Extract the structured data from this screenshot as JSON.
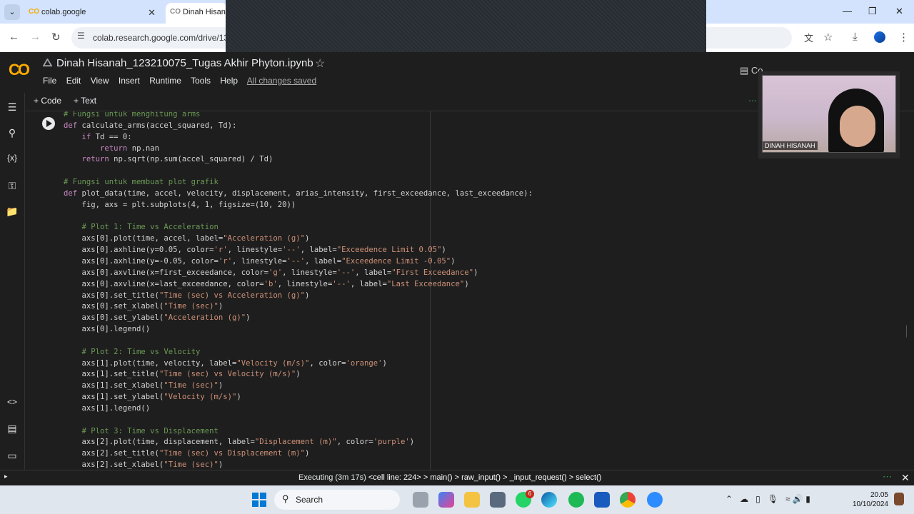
{
  "browser": {
    "tabs": [
      {
        "label": "colab.google"
      },
      {
        "label": "Dinah Hisanah"
      }
    ],
    "url": "colab.research.google.com/drive/13"
  },
  "notebook": {
    "title": "Dinah Hisanah_123210075_Tugas Akhir Phyton.ipynb",
    "menu": [
      "File",
      "Edit",
      "View",
      "Insert",
      "Runtime",
      "Tools",
      "Help"
    ],
    "saved_status": "All changes saved",
    "comment_label": "Co"
  },
  "toolbar": {
    "code_label": "+ Code",
    "text_label": "+ Text"
  },
  "code_lines": [
    "# Fungsi untuk menghitung arms",
    "def calculate_arms(accel_squared, Td):",
    "    if Td == 0:",
    "        return np.nan",
    "    return np.sqrt(np.sum(accel_squared) / Td)",
    "",
    "# Fungsi untuk membuat plot grafik",
    "def plot_data(time, accel, velocity, displacement, arias_intensity, first_exceedance, last_exceedance):",
    "    fig, axs = plt.subplots(4, 1, figsize=(10, 20))",
    "",
    "    # Plot 1: Time vs Acceleration",
    "    axs[0].plot(time, accel, label=\"Acceleration (g)\")",
    "    axs[0].axhline(y=0.05, color='r', linestyle='--', label=\"Exceedence Limit 0.05\")",
    "    axs[0].axhline(y=-0.05, color='r', linestyle='--', label=\"Exceedence Limit -0.05\")",
    "    axs[0].axvline(x=first_exceedance, color='g', linestyle='--', label=\"First Exceedance\")",
    "    axs[0].axvline(x=last_exceedance, color='b', linestyle='--', label=\"Last Exceedance\")",
    "    axs[0].set_title(\"Time (sec) vs Acceleration (g)\")",
    "    axs[0].set_xlabel(\"Time (sec)\")",
    "    axs[0].set_ylabel(\"Acceleration (g)\")",
    "    axs[0].legend()",
    "",
    "    # Plot 2: Time vs Velocity",
    "    axs[1].plot(time, velocity, label=\"Velocity (m/s)\", color='orange')",
    "    axs[1].set_title(\"Time (sec) vs Velocity (m/s)\")",
    "    axs[1].set_xlabel(\"Time (sec)\")",
    "    axs[1].set_ylabel(\"Velocity (m/s)\")",
    "    axs[1].legend()",
    "",
    "    # Plot 3: Time vs Displacement",
    "    axs[2].plot(time, displacement, label=\"Displacement (m)\", color='purple')",
    "    axs[2].set_title(\"Time (sec) vs Displacement (m)\")",
    "    axs[2].set_xlabel(\"Time (sec)\")"
  ],
  "status": {
    "executing": "Executing (3m 17s)",
    "trace": "<cell line: 224> > main() > raw_input() > _input_request() > select()"
  },
  "webcam": {
    "name": "DINAH HISANAH"
  },
  "taskbar": {
    "search_label": "Search",
    "whatsapp_badge": "6",
    "time": "20.05",
    "date": "10/10/2024"
  },
  "colors": {
    "accent": "#f9ab00",
    "editor_bg": "#1e1e1e",
    "comment": "#6a9955",
    "string": "#ce9178"
  }
}
